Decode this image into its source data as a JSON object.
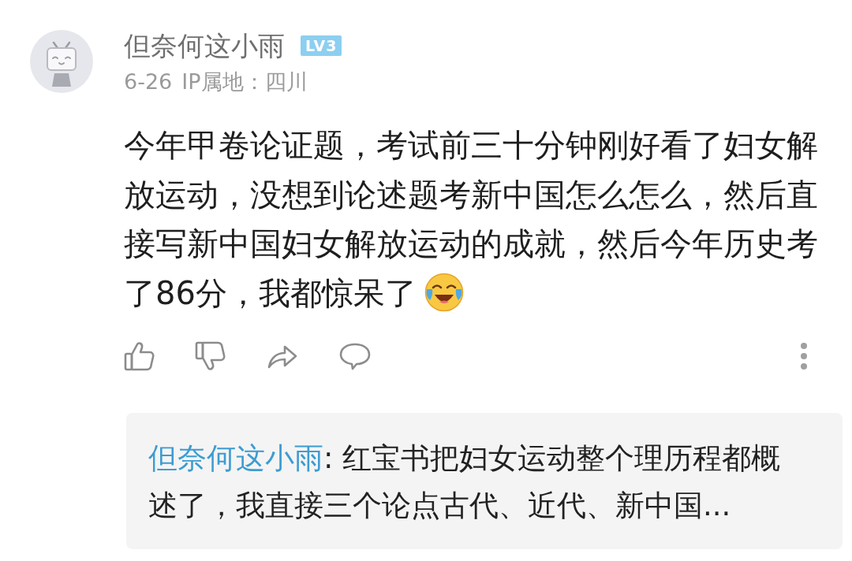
{
  "comment": {
    "author": "但奈何这小雨",
    "level_badge": "LV3",
    "date": "6-26",
    "ip_location": "IP属地：四川",
    "text": "今年甲卷论证题，考试前三十分钟刚好看了妇女解放运动，没想到论述题考新中国怎么怎么，然后直接写新中国妇女解放运动的成就，然后今年历史考了86分，我都惊呆了"
  },
  "reply": {
    "author": "但奈何这小雨",
    "text": ": 红宝书把妇女运动整个理历程都概述了，我直接三个论点古代、近代、新中国..."
  }
}
